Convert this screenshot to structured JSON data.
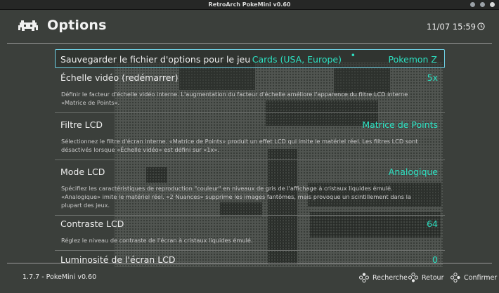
{
  "window": {
    "title": "RetroArch PokeMini v0.60"
  },
  "header": {
    "title": "Options",
    "clock": "11/07 15:59"
  },
  "options": [
    {
      "label": "Sauvegarder le fichier d'options pour le jeu",
      "value_a": "Cards (USA, Europe)",
      "separator": "•",
      "value_b": "Pokemon Z",
      "selected": true
    },
    {
      "label": "Échelle vidéo (redémarrer)",
      "value": "5x",
      "desc": "Définir le facteur d'échelle vidéo interne. L'augmentation du facteur d'échelle améliore l'apparence du filtre LCD interne «Matrice de Points»."
    },
    {
      "label": "Filtre LCD",
      "value": "Matrice de Points",
      "desc": "Sélectionnez le filtre d'écran interne. «Matrice de Points» produit un effet LCD qui imite le matériel réel. Les filtres LCD sont désactivés lorsque «Échelle vidéo» est défini sur «1x»."
    },
    {
      "label": "Mode LCD",
      "value": "Analogique",
      "desc": "Spécifiez les caractéristiques de reproduction \"couleur\" en niveaux de gris de l'affichage à cristaux liquides émulé. «Analogique» imite le matériel réel. «2 Nuances» supprime les images fantômes, mais provoque un scintillement dans la plupart des jeux."
    },
    {
      "label": "Contraste LCD",
      "value": "64",
      "desc": "Réglez le niveau de contraste de l'écran à cristaux liquides émulé."
    },
    {
      "label": "Luminosité de l'écran LCD",
      "value": "0"
    }
  ],
  "footer": {
    "version": "1.7.7 - PokeMini v0.60",
    "search": "Recherche",
    "back": "Retour",
    "confirm": "Confirmer"
  },
  "colors": {
    "accent": "#2de1c2",
    "selection_border": "#6fd2e6",
    "background": "#3b3f3b"
  },
  "icons": [
    "retroarch-logo-icon",
    "clock-icon",
    "gamepad-icon"
  ]
}
